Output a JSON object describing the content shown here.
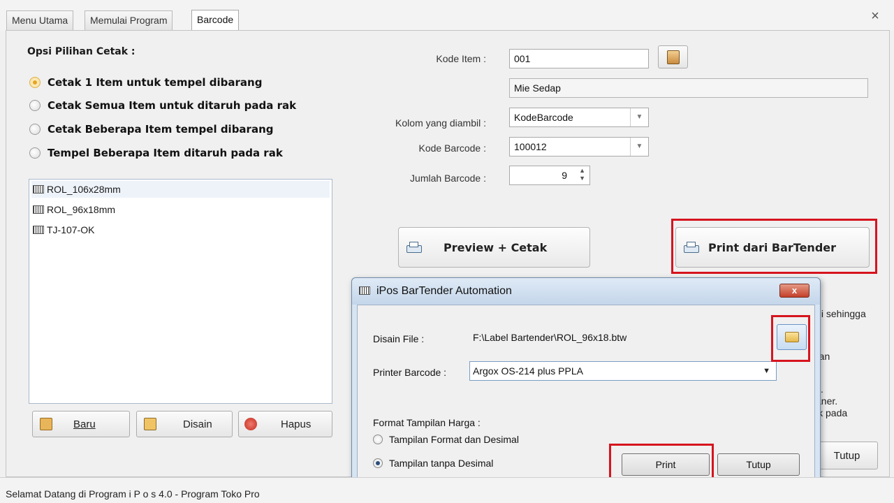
{
  "tabs": [
    {
      "label": "Menu Utama"
    },
    {
      "label": "Memulai Program"
    },
    {
      "label": "Barcode"
    }
  ],
  "close_glyph": "×",
  "left": {
    "title": "Opsi Pilihan Cetak :",
    "options": [
      {
        "label": "Cetak 1 Item untuk tempel dibarang",
        "checked": true
      },
      {
        "label": "Cetak Semua Item untuk ditaruh pada rak",
        "checked": false
      },
      {
        "label": "Cetak Beberapa Item tempel dibarang",
        "checked": false
      },
      {
        "label": "Tempel Beberapa Item ditaruh pada rak",
        "checked": false
      }
    ],
    "templates": [
      "ROL_106x28mm",
      "ROL_96x18mm",
      "TJ-107-OK"
    ],
    "buttons": {
      "baru": "Baru",
      "disain": "Disain",
      "hapus": "Hapus"
    }
  },
  "form": {
    "kode_item_label": "Kode Item :",
    "kode_item_value": "001",
    "item_name": "Mie Sedap",
    "kolom_label": "Kolom yang diambil :",
    "kolom_value": "KodeBarcode",
    "kode_barcode_label": "Kode Barcode :",
    "kode_barcode_value": "100012",
    "jumlah_label": "Jumlah Barcode :",
    "jumlah_value": "9",
    "preview_button": "Preview + Cetak",
    "bartender_button": "Print dari BarTender",
    "tutup_button": "Tutup"
  },
  "background_text": [
    "ali sehingga",
    "ran",
    "k.",
    "aner.",
    "ik pada"
  ],
  "dialog": {
    "title": "iPos BarTender Automation",
    "close_glyph": "x",
    "disain_label": "Disain File :",
    "disain_value": "F:\\Label Bartender\\ROL_96x18.btw",
    "printer_label": "Printer Barcode :",
    "printer_value": "Argox OS-214 plus PPLA",
    "format_label": "Format Tampilan Harga :",
    "format_options": [
      {
        "label": "Tampilan Format dan Desimal",
        "checked": false
      },
      {
        "label": "Tampilan tanpa Desimal",
        "checked": true
      }
    ],
    "print_button": "Print",
    "tutup_button": "Tutup"
  },
  "status_bar": "Selamat Datang di Program i P o s  4.0 - Program Toko Pro",
  "colors": {
    "highlight": "#d6141e",
    "radio_selected": "#e8a323"
  }
}
